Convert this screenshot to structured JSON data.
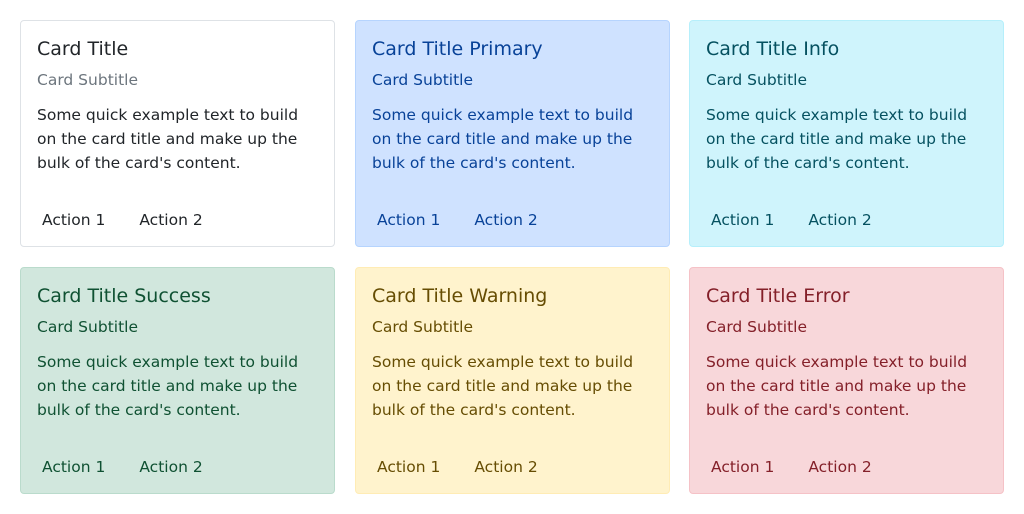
{
  "cards": [
    {
      "variant": "default",
      "title": "Card Title",
      "subtitle": "Card Subtitle",
      "text": "Some quick example text to build on the card title and make up the bulk of the card's content.",
      "actions": [
        "Action 1",
        "Action 2"
      ],
      "colors": {
        "background": "#ffffff",
        "border": "#dee2e6",
        "text": "#212529",
        "subtitle": "#6c757d"
      }
    },
    {
      "variant": "primary",
      "title": "Card Title Primary",
      "subtitle": "Card Subtitle",
      "text": "Some quick example text to build on the card title and make up the bulk of the card's content.",
      "actions": [
        "Action 1",
        "Action 2"
      ],
      "colors": {
        "background": "#cfe2ff",
        "border": "#b6d4fe",
        "text": "#084298"
      }
    },
    {
      "variant": "info",
      "title": "Card Title Info",
      "subtitle": "Card Subtitle",
      "text": "Some quick example text to build on the card title and make up the bulk of the card's content.",
      "actions": [
        "Action 1",
        "Action 2"
      ],
      "colors": {
        "background": "#cff4fc",
        "border": "#b6effb",
        "text": "#055160"
      }
    },
    {
      "variant": "success",
      "title": "Card Title Success",
      "subtitle": "Card Subtitle",
      "text": "Some quick example text to build on the card title and make up the bulk of the card's content.",
      "actions": [
        "Action 1",
        "Action 2"
      ],
      "colors": {
        "background": "#d1e7dd",
        "border": "#badbcc",
        "text": "#0f5132"
      }
    },
    {
      "variant": "warning",
      "title": "Card Title Warning",
      "subtitle": "Card Subtitle",
      "text": "Some quick example text to build on the card title and make up the bulk of the card's content.",
      "actions": [
        "Action 1",
        "Action 2"
      ],
      "colors": {
        "background": "#fff3cd",
        "border": "#ffecb5",
        "text": "#664d03"
      }
    },
    {
      "variant": "error",
      "title": "Card Title Error",
      "subtitle": "Card Subtitle",
      "text": "Some quick example text to build on the card title and make up the bulk of the card's content.",
      "actions": [
        "Action 1",
        "Action 2"
      ],
      "colors": {
        "background": "#f8d7da",
        "border": "#f5c2c7",
        "text": "#842029"
      }
    }
  ]
}
